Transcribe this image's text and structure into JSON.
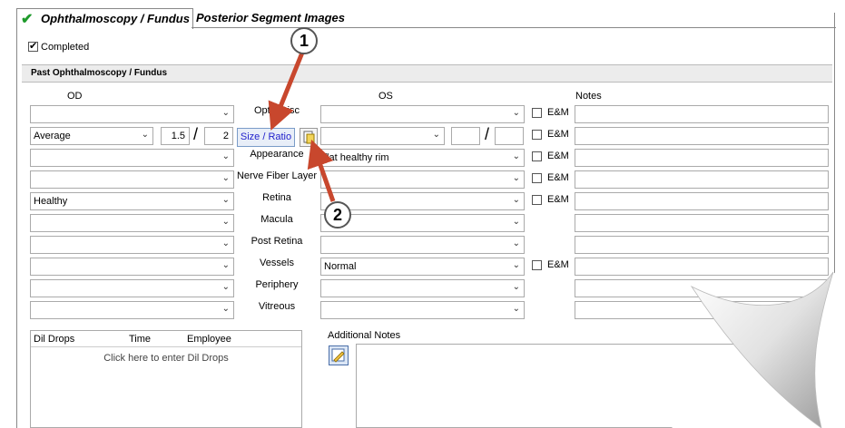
{
  "tabs": [
    {
      "label": "Ophthalmoscopy / Fundus",
      "active": true
    },
    {
      "label": "Posterior Segment Images",
      "active": false
    }
  ],
  "completed": {
    "label": "Completed",
    "checked": true
  },
  "section_title": "Past Ophthalmoscopy / Fundus",
  "columns": {
    "od": "OD",
    "os": "OS",
    "notes": "Notes"
  },
  "rows": [
    {
      "label": "Optic Disc",
      "od": "",
      "os": "",
      "em": true
    },
    {
      "label": "",
      "od": "Average",
      "os": "",
      "em": true
    },
    {
      "label": "Appearance",
      "od": "",
      "os": "flat healthy rim",
      "em": true
    },
    {
      "label": "Nerve Fiber Layer",
      "od": "",
      "os": "",
      "em": true
    },
    {
      "label": "Retina",
      "od": "Healthy",
      "os": "",
      "em": true
    },
    {
      "label": "Macula",
      "od": "",
      "os": "",
      "em": false
    },
    {
      "label": "Post Retina",
      "od": "",
      "os": "",
      "em": false
    },
    {
      "label": "Vessels",
      "od": "",
      "os": "Normal",
      "em": true
    },
    {
      "label": "Periphery",
      "od": "",
      "os": "",
      "em": false
    },
    {
      "label": "Vitreous",
      "od": "",
      "os": "",
      "em": false
    }
  ],
  "em_label": "E&M",
  "ratio": {
    "od_num": "1.5",
    "od_den": "2",
    "os_num": "",
    "os_den": "",
    "slash": "/"
  },
  "size_ratio_button": "Size / Ratio",
  "dil_drops": {
    "headers": [
      "Dil Drops",
      "Time",
      "Employee"
    ],
    "empty_text": "Click here to enter Dil Drops"
  },
  "additional_notes_label": "Additional Notes",
  "callouts": [
    "1",
    "2"
  ],
  "colors": {
    "check_green": "#1e9a2b",
    "arrow_red": "#c8472d",
    "button_text": "#2222cc"
  }
}
